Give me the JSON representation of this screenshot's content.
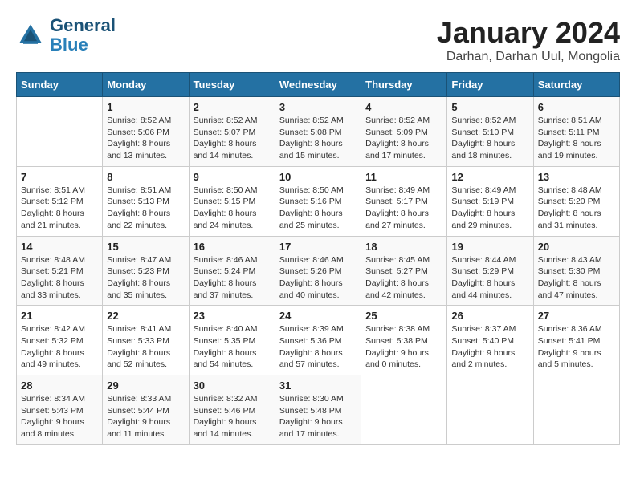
{
  "logo": {
    "line1": "General",
    "line2": "Blue"
  },
  "title": "January 2024",
  "location": "Darhan, Darhan Uul, Mongolia",
  "days_header": [
    "Sunday",
    "Monday",
    "Tuesday",
    "Wednesday",
    "Thursday",
    "Friday",
    "Saturday"
  ],
  "weeks": [
    [
      {
        "day": "",
        "sunrise": "",
        "sunset": "",
        "daylight": ""
      },
      {
        "day": "1",
        "sunrise": "Sunrise: 8:52 AM",
        "sunset": "Sunset: 5:06 PM",
        "daylight": "Daylight: 8 hours and 13 minutes."
      },
      {
        "day": "2",
        "sunrise": "Sunrise: 8:52 AM",
        "sunset": "Sunset: 5:07 PM",
        "daylight": "Daylight: 8 hours and 14 minutes."
      },
      {
        "day": "3",
        "sunrise": "Sunrise: 8:52 AM",
        "sunset": "Sunset: 5:08 PM",
        "daylight": "Daylight: 8 hours and 15 minutes."
      },
      {
        "day": "4",
        "sunrise": "Sunrise: 8:52 AM",
        "sunset": "Sunset: 5:09 PM",
        "daylight": "Daylight: 8 hours and 17 minutes."
      },
      {
        "day": "5",
        "sunrise": "Sunrise: 8:52 AM",
        "sunset": "Sunset: 5:10 PM",
        "daylight": "Daylight: 8 hours and 18 minutes."
      },
      {
        "day": "6",
        "sunrise": "Sunrise: 8:51 AM",
        "sunset": "Sunset: 5:11 PM",
        "daylight": "Daylight: 8 hours and 19 minutes."
      }
    ],
    [
      {
        "day": "7",
        "sunrise": "Sunrise: 8:51 AM",
        "sunset": "Sunset: 5:12 PM",
        "daylight": "Daylight: 8 hours and 21 minutes."
      },
      {
        "day": "8",
        "sunrise": "Sunrise: 8:51 AM",
        "sunset": "Sunset: 5:13 PM",
        "daylight": "Daylight: 8 hours and 22 minutes."
      },
      {
        "day": "9",
        "sunrise": "Sunrise: 8:50 AM",
        "sunset": "Sunset: 5:15 PM",
        "daylight": "Daylight: 8 hours and 24 minutes."
      },
      {
        "day": "10",
        "sunrise": "Sunrise: 8:50 AM",
        "sunset": "Sunset: 5:16 PM",
        "daylight": "Daylight: 8 hours and 25 minutes."
      },
      {
        "day": "11",
        "sunrise": "Sunrise: 8:49 AM",
        "sunset": "Sunset: 5:17 PM",
        "daylight": "Daylight: 8 hours and 27 minutes."
      },
      {
        "day": "12",
        "sunrise": "Sunrise: 8:49 AM",
        "sunset": "Sunset: 5:19 PM",
        "daylight": "Daylight: 8 hours and 29 minutes."
      },
      {
        "day": "13",
        "sunrise": "Sunrise: 8:48 AM",
        "sunset": "Sunset: 5:20 PM",
        "daylight": "Daylight: 8 hours and 31 minutes."
      }
    ],
    [
      {
        "day": "14",
        "sunrise": "Sunrise: 8:48 AM",
        "sunset": "Sunset: 5:21 PM",
        "daylight": "Daylight: 8 hours and 33 minutes."
      },
      {
        "day": "15",
        "sunrise": "Sunrise: 8:47 AM",
        "sunset": "Sunset: 5:23 PM",
        "daylight": "Daylight: 8 hours and 35 minutes."
      },
      {
        "day": "16",
        "sunrise": "Sunrise: 8:46 AM",
        "sunset": "Sunset: 5:24 PM",
        "daylight": "Daylight: 8 hours and 37 minutes."
      },
      {
        "day": "17",
        "sunrise": "Sunrise: 8:46 AM",
        "sunset": "Sunset: 5:26 PM",
        "daylight": "Daylight: 8 hours and 40 minutes."
      },
      {
        "day": "18",
        "sunrise": "Sunrise: 8:45 AM",
        "sunset": "Sunset: 5:27 PM",
        "daylight": "Daylight: 8 hours and 42 minutes."
      },
      {
        "day": "19",
        "sunrise": "Sunrise: 8:44 AM",
        "sunset": "Sunset: 5:29 PM",
        "daylight": "Daylight: 8 hours and 44 minutes."
      },
      {
        "day": "20",
        "sunrise": "Sunrise: 8:43 AM",
        "sunset": "Sunset: 5:30 PM",
        "daylight": "Daylight: 8 hours and 47 minutes."
      }
    ],
    [
      {
        "day": "21",
        "sunrise": "Sunrise: 8:42 AM",
        "sunset": "Sunset: 5:32 PM",
        "daylight": "Daylight: 8 hours and 49 minutes."
      },
      {
        "day": "22",
        "sunrise": "Sunrise: 8:41 AM",
        "sunset": "Sunset: 5:33 PM",
        "daylight": "Daylight: 8 hours and 52 minutes."
      },
      {
        "day": "23",
        "sunrise": "Sunrise: 8:40 AM",
        "sunset": "Sunset: 5:35 PM",
        "daylight": "Daylight: 8 hours and 54 minutes."
      },
      {
        "day": "24",
        "sunrise": "Sunrise: 8:39 AM",
        "sunset": "Sunset: 5:36 PM",
        "daylight": "Daylight: 8 hours and 57 minutes."
      },
      {
        "day": "25",
        "sunrise": "Sunrise: 8:38 AM",
        "sunset": "Sunset: 5:38 PM",
        "daylight": "Daylight: 9 hours and 0 minutes."
      },
      {
        "day": "26",
        "sunrise": "Sunrise: 8:37 AM",
        "sunset": "Sunset: 5:40 PM",
        "daylight": "Daylight: 9 hours and 2 minutes."
      },
      {
        "day": "27",
        "sunrise": "Sunrise: 8:36 AM",
        "sunset": "Sunset: 5:41 PM",
        "daylight": "Daylight: 9 hours and 5 minutes."
      }
    ],
    [
      {
        "day": "28",
        "sunrise": "Sunrise: 8:34 AM",
        "sunset": "Sunset: 5:43 PM",
        "daylight": "Daylight: 9 hours and 8 minutes."
      },
      {
        "day": "29",
        "sunrise": "Sunrise: 8:33 AM",
        "sunset": "Sunset: 5:44 PM",
        "daylight": "Daylight: 9 hours and 11 minutes."
      },
      {
        "day": "30",
        "sunrise": "Sunrise: 8:32 AM",
        "sunset": "Sunset: 5:46 PM",
        "daylight": "Daylight: 9 hours and 14 minutes."
      },
      {
        "day": "31",
        "sunrise": "Sunrise: 8:30 AM",
        "sunset": "Sunset: 5:48 PM",
        "daylight": "Daylight: 9 hours and 17 minutes."
      },
      {
        "day": "",
        "sunrise": "",
        "sunset": "",
        "daylight": ""
      },
      {
        "day": "",
        "sunrise": "",
        "sunset": "",
        "daylight": ""
      },
      {
        "day": "",
        "sunrise": "",
        "sunset": "",
        "daylight": ""
      }
    ]
  ]
}
